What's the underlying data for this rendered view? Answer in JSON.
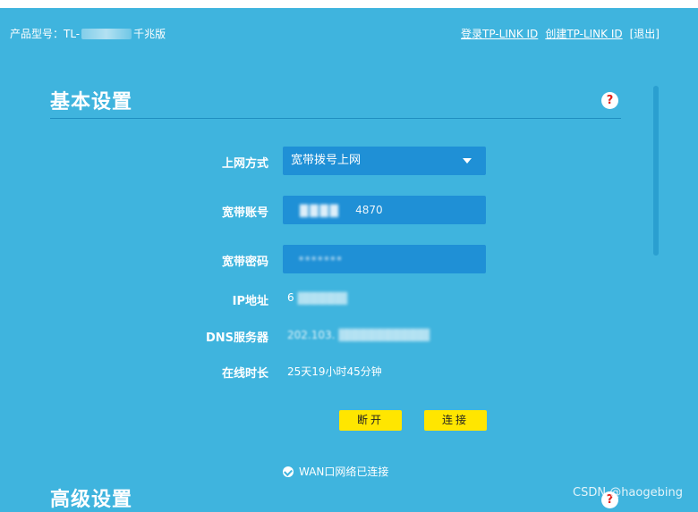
{
  "header": {
    "product_label": "产品型号：TL-",
    "product_suffix": "千兆版",
    "login_link": "登录TP-LINK ID",
    "create_link": "创建TP-LINK ID",
    "logout": "[退出]"
  },
  "basic": {
    "title": "基本设置",
    "help": "?",
    "fields": {
      "mode_label": "上网方式",
      "mode_value": "宽带拨号上网",
      "account_label": "宽带账号",
      "account_value": "4870",
      "password_label": "宽带密码",
      "password_value": "•••••••",
      "ip_label": "IP地址",
      "ip_value": "6",
      "dns_label": "DNS服务器",
      "dns_value": "202.103.",
      "uptime_label": "在线时长",
      "uptime_value": "25天19小时45分钟"
    },
    "disconnect_button": "断开",
    "connect_button": "连接",
    "wan_status": "WAN口网络已连接"
  },
  "advanced": {
    "title": "高级设置",
    "help": "?"
  },
  "watermark": "CSDN @haogebing",
  "colors": {
    "background": "#3fb4de",
    "field": "#1f90d6",
    "button": "#ffe600",
    "help_mark": "#e0231b"
  },
  "icons": {
    "help": "question-mark-circle",
    "select": "triangle-down",
    "status": "check-circle"
  }
}
